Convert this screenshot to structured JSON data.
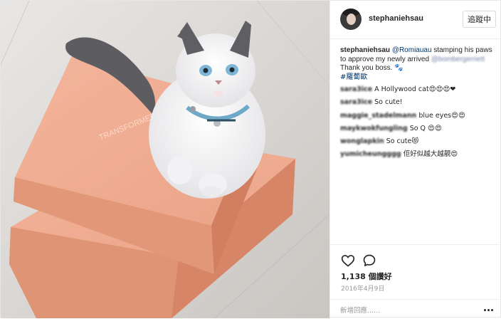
{
  "post": {
    "username": "stephaniehsau",
    "follow_label": "追蹤中",
    "caption": {
      "author": "stephaniehsau",
      "mention": "@Romiauau",
      "text1": " stamping his paws to approve my newly arrived ",
      "blurred_mention": "@bombergerriett",
      "text2": " Thank you boss. 🐾",
      "hashtag": "#羅蔔歐"
    },
    "comments": [
      {
        "user": "sara3ice",
        "text": "A Hollywood cat😍😍😍❤"
      },
      {
        "user": "sara3ice",
        "text": "So cute!"
      },
      {
        "user": "maggie_stadelmann",
        "text": "blue eyes😍😍"
      },
      {
        "user": "maykwokfungling",
        "text": "So Q 😍😍"
      },
      {
        "user": "wonglapkin",
        "text": "So cute😻"
      },
      {
        "user": "yumicheungggg",
        "text": "佢好似越大越靚😍"
      }
    ],
    "likes": "1,138 個讚好",
    "date": "2016年4月9日",
    "add_comment_placeholder": "新增回應......",
    "icons": {
      "like": "heart-outline",
      "comment": "speech-bubble",
      "more": "more-horizontal"
    }
  }
}
